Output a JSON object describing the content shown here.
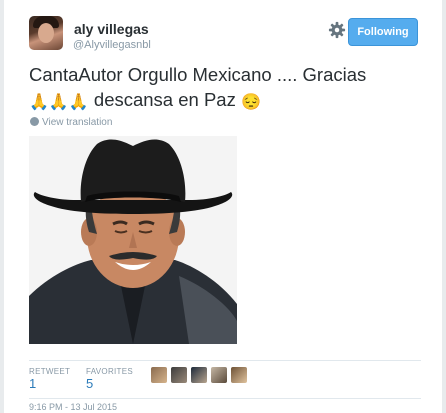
{
  "header": {
    "display_name": "aly villegas",
    "screen_name": "@Alyvillegasnbl",
    "follow_label": "Following"
  },
  "tweet": {
    "line1": "CantaAutor  Orgullo Mexicano .... Gracias",
    "emoji_praying": "🙏",
    "line2_text": " descansa en Paz ",
    "emoji_relieved": "😔",
    "translate_label": "View translation"
  },
  "stats": {
    "retweet_label": "RETWEET",
    "retweet_count": "1",
    "favorites_label": "FAVORITES",
    "favorites_count": "5"
  },
  "timestamp": "9:16 PM - 13 Jul 2015",
  "colors": {
    "follow_button": "#55acee",
    "link_blue": "#2b7bb9",
    "muted_text": "#8899a6"
  },
  "icons": [
    "gear-icon",
    "globe-icon",
    "praying-hands-emoji",
    "relieved-face-emoji"
  ]
}
